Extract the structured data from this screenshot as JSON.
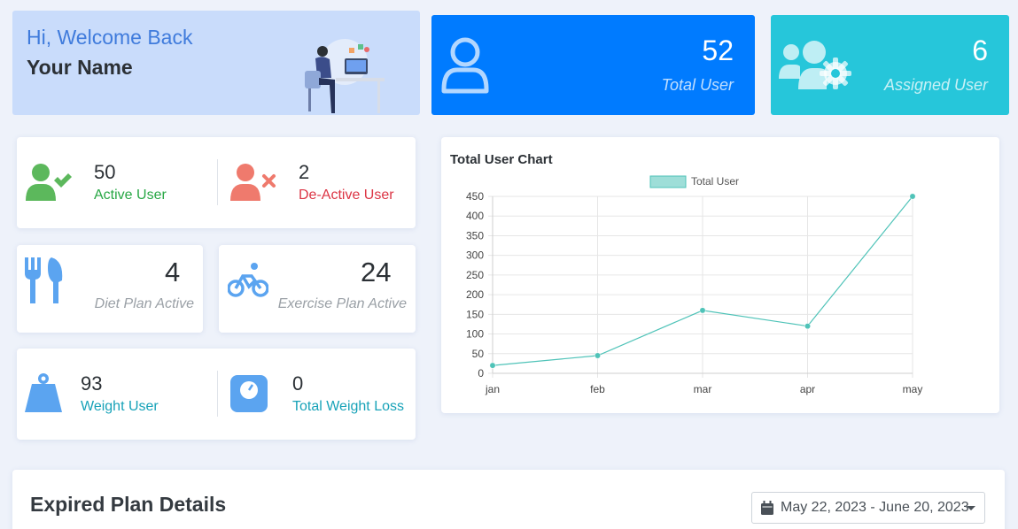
{
  "welcome": {
    "greeting": "Hi, Welcome Back",
    "name": "Your Name"
  },
  "tiles": {
    "total_user": {
      "value": "52",
      "label": "Total User",
      "color": "#007bff",
      "icon": "user-icon"
    },
    "assigned_user": {
      "value": "6",
      "label": "Assigned User",
      "color": "#26c6da",
      "icon": "users-gear-icon"
    }
  },
  "user_status": {
    "active": {
      "value": "50",
      "label": "Active User",
      "color": "#28a745",
      "icon": "user-check-icon"
    },
    "deactive": {
      "value": "2",
      "label": "De-Active User",
      "color": "#dc3545",
      "icon": "user-times-icon"
    }
  },
  "plans": {
    "diet": {
      "value": "4",
      "label": "Diet Plan Active",
      "icon": "utensils-icon"
    },
    "exercise": {
      "value": "24",
      "label": "Exercise Plan Active",
      "icon": "bicycle-icon"
    }
  },
  "weight": {
    "weight_user": {
      "value": "93",
      "label": "Weight User",
      "color": "#17a2b8",
      "icon": "weight-icon"
    },
    "total_loss": {
      "value": "0",
      "label": "Total Weight Loss",
      "color": "#17a2b8",
      "icon": "scale-icon"
    }
  },
  "chart": {
    "title": "Total User Chart",
    "chart_data": {
      "type": "line",
      "categories": [
        "jan",
        "feb",
        "mar",
        "apr",
        "may"
      ],
      "series": [
        {
          "name": "Total User",
          "values": [
            20,
            45,
            160,
            120,
            450
          ],
          "color": "#4fc3b8"
        }
      ],
      "ylim": [
        0,
        450
      ],
      "yticks": [
        0,
        50,
        100,
        150,
        200,
        250,
        300,
        350,
        400,
        450
      ],
      "grid": true,
      "legend": "top-center"
    }
  },
  "expired": {
    "title": "Expired Plan Details",
    "date_range": "May 22, 2023 - June 20, 2023"
  }
}
